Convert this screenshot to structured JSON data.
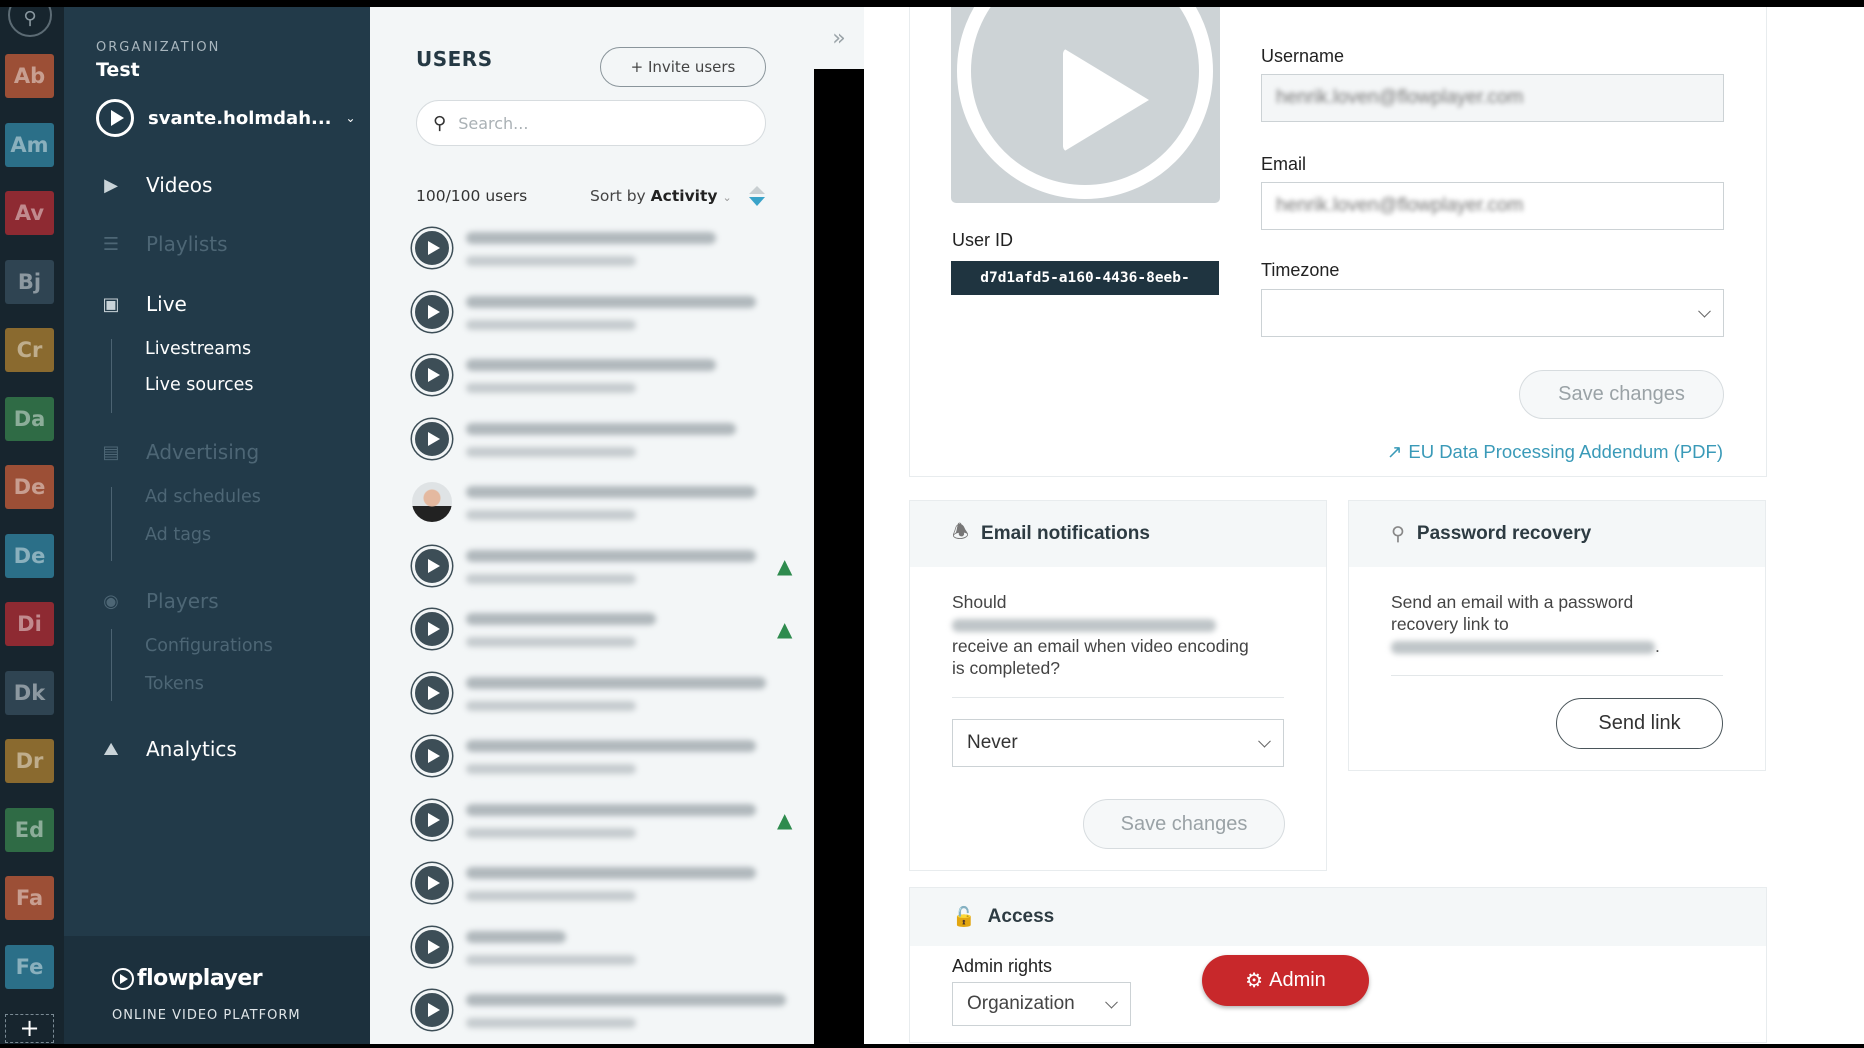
{
  "org_rail": {
    "tiles": [
      {
        "label": "Ab",
        "color": "#9c4f36"
      },
      {
        "label": "Am",
        "color": "#2b6f88"
      },
      {
        "label": "Av",
        "color": "#8e2a32"
      },
      {
        "label": "Bj",
        "color": "#2f4452"
      },
      {
        "label": "Cr",
        "color": "#8a6a2f"
      },
      {
        "label": "Da",
        "color": "#2f6b45"
      },
      {
        "label": "De",
        "color": "#9c4f36"
      },
      {
        "label": "De",
        "color": "#2b6f88"
      },
      {
        "label": "Di",
        "color": "#8e2a32"
      },
      {
        "label": "Dk",
        "color": "#2f4452"
      },
      {
        "label": "Dr",
        "color": "#8a6a2f"
      },
      {
        "label": "Ed",
        "color": "#2f6b45"
      },
      {
        "label": "Fa",
        "color": "#9c4f36"
      },
      {
        "label": "Fe",
        "color": "#2b6f88"
      }
    ],
    "add_label": "+"
  },
  "sidebar": {
    "org_label": "ORGANIZATION",
    "org_name": "Test",
    "user": "svante.holmdah...",
    "nav": {
      "videos": "Videos",
      "playlists": "Playlists",
      "live": "Live",
      "livestreams": "Livestreams",
      "live_sources": "Live sources",
      "advertising": "Advertising",
      "ad_schedules": "Ad schedules",
      "ad_tags": "Ad tags",
      "players": "Players",
      "configurations": "Configurations",
      "tokens": "Tokens",
      "analytics": "Analytics"
    },
    "logo": "flowplayer",
    "tagline": "ONLINE VIDEO PLATFORM"
  },
  "users": {
    "title": "USERS",
    "invite_label": "+ Invite users",
    "search_placeholder": "Search...",
    "count": "100/100 users",
    "sort_prefix": "Sort by",
    "sort_value": "Activity",
    "sort_arrow_color": "#3aa3c9",
    "warning_color": "#2e8b4e",
    "rows": [
      {
        "avatar": "play",
        "warning": false
      },
      {
        "avatar": "play",
        "warning": false
      },
      {
        "avatar": "play",
        "warning": false
      },
      {
        "avatar": "play",
        "warning": false
      },
      {
        "avatar": "photo",
        "warning": false
      },
      {
        "avatar": "play",
        "warning": true
      },
      {
        "avatar": "play",
        "warning": true
      },
      {
        "avatar": "play",
        "warning": false
      },
      {
        "avatar": "play",
        "warning": false
      },
      {
        "avatar": "play",
        "warning": true
      },
      {
        "avatar": "play",
        "warning": false
      },
      {
        "avatar": "play",
        "warning": false
      },
      {
        "avatar": "play",
        "warning": false
      }
    ]
  },
  "profile": {
    "user_id_label": "User ID",
    "user_id": "d7d1afd5-a160-4436-8eeb-",
    "username_label": "Username",
    "username_value": "henrik.loven@flowplayer.com",
    "email_label": "Email",
    "email_value": "henrik.loven@flowplayer.com",
    "timezone_label": "Timezone",
    "timezone_value": "",
    "save_label": "Save changes",
    "dpa_link": "EU Data Processing Addendum (PDF)",
    "link_color": "#3a9ab8"
  },
  "email_notifications": {
    "title": "Email notifications",
    "text_before": "Should",
    "text_after": "receive an email when video encoding is completed?",
    "select_value": "Never",
    "save_label": "Save changes"
  },
  "password_recovery": {
    "title": "Password recovery",
    "text": "Send an email with a password recovery link to",
    "send_label": "Send link"
  },
  "access": {
    "title": "Access",
    "admin_rights_label": "Admin rights",
    "scope_value": "Organization",
    "admin_button": "Admin",
    "admin_color": "#c8282b"
  }
}
